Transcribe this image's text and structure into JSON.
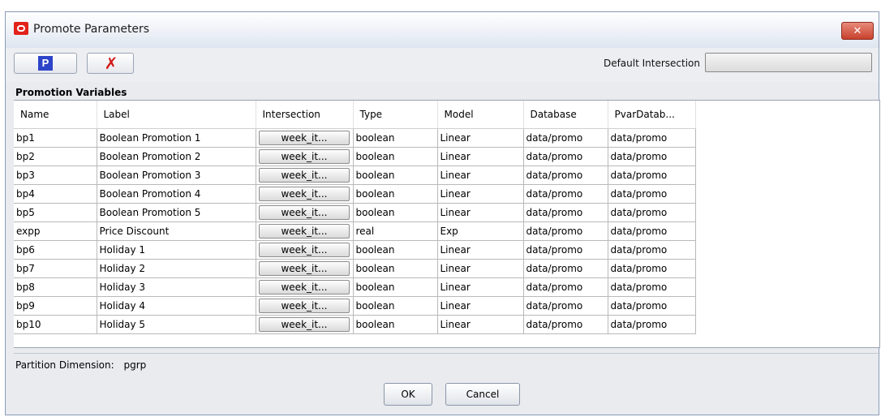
{
  "window": {
    "title": "Promote Parameters",
    "close_glyph": "✕"
  },
  "toolbar": {
    "promote_glyph": "P",
    "delete_glyph": "✗",
    "default_intersection_label": "Default Intersection",
    "default_intersection_value": ""
  },
  "section": {
    "title": "Promotion Variables"
  },
  "table": {
    "headers": [
      "Name",
      "Label",
      "Intersection",
      "Type",
      "Model",
      "Database",
      "PvarDatab..."
    ],
    "rows": [
      {
        "name": "bp1",
        "label": "Boolean Promotion 1",
        "intersection": "week_it...",
        "type": "boolean",
        "model": "Linear",
        "database": "data/promo",
        "pvardb": "data/promo"
      },
      {
        "name": "bp2",
        "label": "Boolean Promotion 2",
        "intersection": "week_it...",
        "type": "boolean",
        "model": "Linear",
        "database": "data/promo",
        "pvardb": "data/promo"
      },
      {
        "name": "bp3",
        "label": "Boolean Promotion 3",
        "intersection": "week_it...",
        "type": "boolean",
        "model": "Linear",
        "database": "data/promo",
        "pvardb": "data/promo"
      },
      {
        "name": "bp4",
        "label": "Boolean Promotion 4",
        "intersection": "week_it...",
        "type": "boolean",
        "model": "Linear",
        "database": "data/promo",
        "pvardb": "data/promo"
      },
      {
        "name": "bp5",
        "label": "Boolean Promotion 5",
        "intersection": "week_it...",
        "type": "boolean",
        "model": "Linear",
        "database": "data/promo",
        "pvardb": "data/promo"
      },
      {
        "name": "expp",
        "label": "Price Discount",
        "intersection": "week_it...",
        "type": "real",
        "model": "Exp",
        "database": "data/promo",
        "pvardb": "data/promo"
      },
      {
        "name": "bp6",
        "label": "Holiday 1",
        "intersection": "week_it...",
        "type": "boolean",
        "model": "Linear",
        "database": "data/promo",
        "pvardb": "data/promo"
      },
      {
        "name": "bp7",
        "label": "Holiday 2",
        "intersection": "week_it...",
        "type": "boolean",
        "model": "Linear",
        "database": "data/promo",
        "pvardb": "data/promo"
      },
      {
        "name": "bp8",
        "label": "Holiday 3",
        "intersection": "week_it...",
        "type": "boolean",
        "model": "Linear",
        "database": "data/promo",
        "pvardb": "data/promo"
      },
      {
        "name": "bp9",
        "label": "Holiday 4",
        "intersection": "week_it...",
        "type": "boolean",
        "model": "Linear",
        "database": "data/promo",
        "pvardb": "data/promo"
      },
      {
        "name": "bp10",
        "label": "Holiday 5",
        "intersection": "week_it...",
        "type": "boolean",
        "model": "Linear",
        "database": "data/promo",
        "pvardb": "data/promo"
      }
    ]
  },
  "footer": {
    "partition_label": "Partition Dimension:",
    "partition_value": "pgrp",
    "ok_label": "OK",
    "cancel_label": "Cancel"
  }
}
